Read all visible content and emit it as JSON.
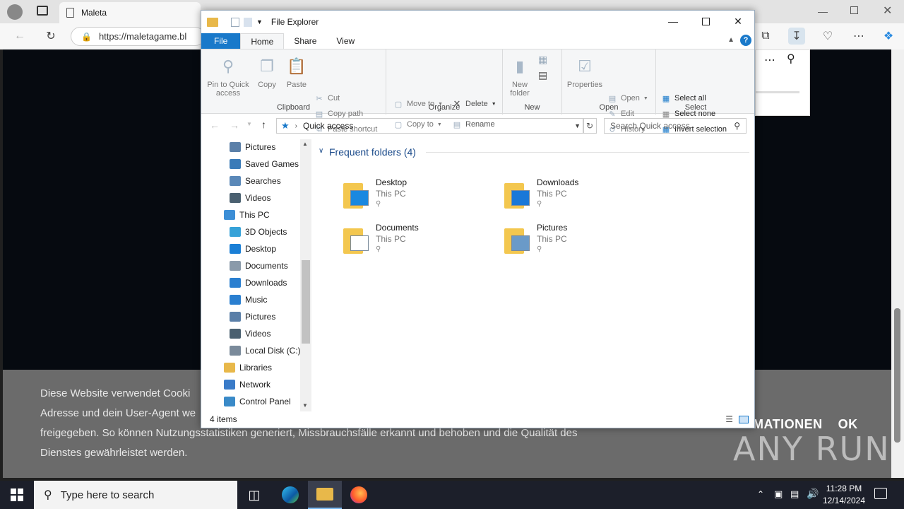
{
  "browser": {
    "tab_title": "Maleta",
    "url": "https://maletagame.bl"
  },
  "cookie_banner": {
    "line1": "Diese Website verwendet Cooki",
    "line2": "Adresse und dein User-Agent we",
    "line3": "freigegeben. So können Nutzungsstatistiken generiert, Missbrauchsfälle erkannt und behoben und die Qualität des",
    "line4": "Dienstes gewährleistet werden.",
    "more_info": "MATIONEN",
    "ok": "OK"
  },
  "watermark": "ANY RUN",
  "explorer": {
    "title": "File Explorer",
    "tabs": {
      "file": "File",
      "home": "Home",
      "share": "Share",
      "view": "View"
    },
    "ribbon": {
      "clipboard": {
        "label": "Clipboard",
        "pin": "Pin to Quick access",
        "copy": "Copy",
        "paste": "Paste",
        "cut": "Cut",
        "copy_path": "Copy path",
        "paste_shortcut": "Paste shortcut"
      },
      "organize": {
        "label": "Organize",
        "move_to": "Move to",
        "copy_to": "Copy to",
        "delete": "Delete",
        "rename": "Rename"
      },
      "new": {
        "label": "New",
        "new_folder": "New folder"
      },
      "open": {
        "label": "Open",
        "properties": "Properties",
        "open": "Open",
        "edit": "Edit",
        "history": "History"
      },
      "select": {
        "label": "Select",
        "select_all": "Select all",
        "select_none": "Select none",
        "invert": "Invert selection"
      }
    },
    "path": "Quick access",
    "search_placeholder": "Search Quick access",
    "nav": [
      {
        "label": "Pictures",
        "icon": "pictures-icon",
        "color": "#5a7fa8"
      },
      {
        "label": "Saved Games",
        "icon": "saved-games-icon",
        "color": "#3a7bb8"
      },
      {
        "label": "Searches",
        "icon": "searches-icon",
        "color": "#5a88b8"
      },
      {
        "label": "Videos",
        "icon": "videos-icon",
        "color": "#4a6070"
      },
      {
        "label": "This PC",
        "icon": "this-pc-icon",
        "color": "#3c8ed6"
      },
      {
        "label": "3D Objects",
        "icon": "3d-objects-icon",
        "color": "#36a2d8"
      },
      {
        "label": "Desktop",
        "icon": "desktop-icon",
        "color": "#1a7fd6"
      },
      {
        "label": "Documents",
        "icon": "documents-icon",
        "color": "#8a9aaa"
      },
      {
        "label": "Downloads",
        "icon": "downloads-icon",
        "color": "#2a7fd0"
      },
      {
        "label": "Music",
        "icon": "music-icon",
        "color": "#2a7fd0"
      },
      {
        "label": "Pictures",
        "icon": "pictures-icon",
        "color": "#5a7fa8"
      },
      {
        "label": "Videos",
        "icon": "videos-icon",
        "color": "#4a6070"
      },
      {
        "label": "Local Disk (C:)",
        "icon": "local-disk-icon",
        "color": "#7a8a9a"
      },
      {
        "label": "Libraries",
        "icon": "libraries-icon",
        "color": "#e8b84a"
      },
      {
        "label": "Network",
        "icon": "network-icon",
        "color": "#3a7bc8"
      },
      {
        "label": "Control Panel",
        "icon": "control-panel-icon",
        "color": "#3a8ac8"
      }
    ],
    "section_title": "Frequent folders (4)",
    "folders": [
      {
        "name": "Desktop",
        "location": "This PC",
        "icon": "desktop-folder-icon"
      },
      {
        "name": "Downloads",
        "location": "This PC",
        "icon": "downloads-folder-icon"
      },
      {
        "name": "Documents",
        "location": "This PC",
        "icon": "documents-folder-icon"
      },
      {
        "name": "Pictures",
        "location": "This PC",
        "icon": "pictures-folder-icon"
      }
    ],
    "status": "4 items"
  },
  "taskbar": {
    "search_placeholder": "Type here to search",
    "time": "11:28 PM",
    "date": "12/14/2024"
  }
}
